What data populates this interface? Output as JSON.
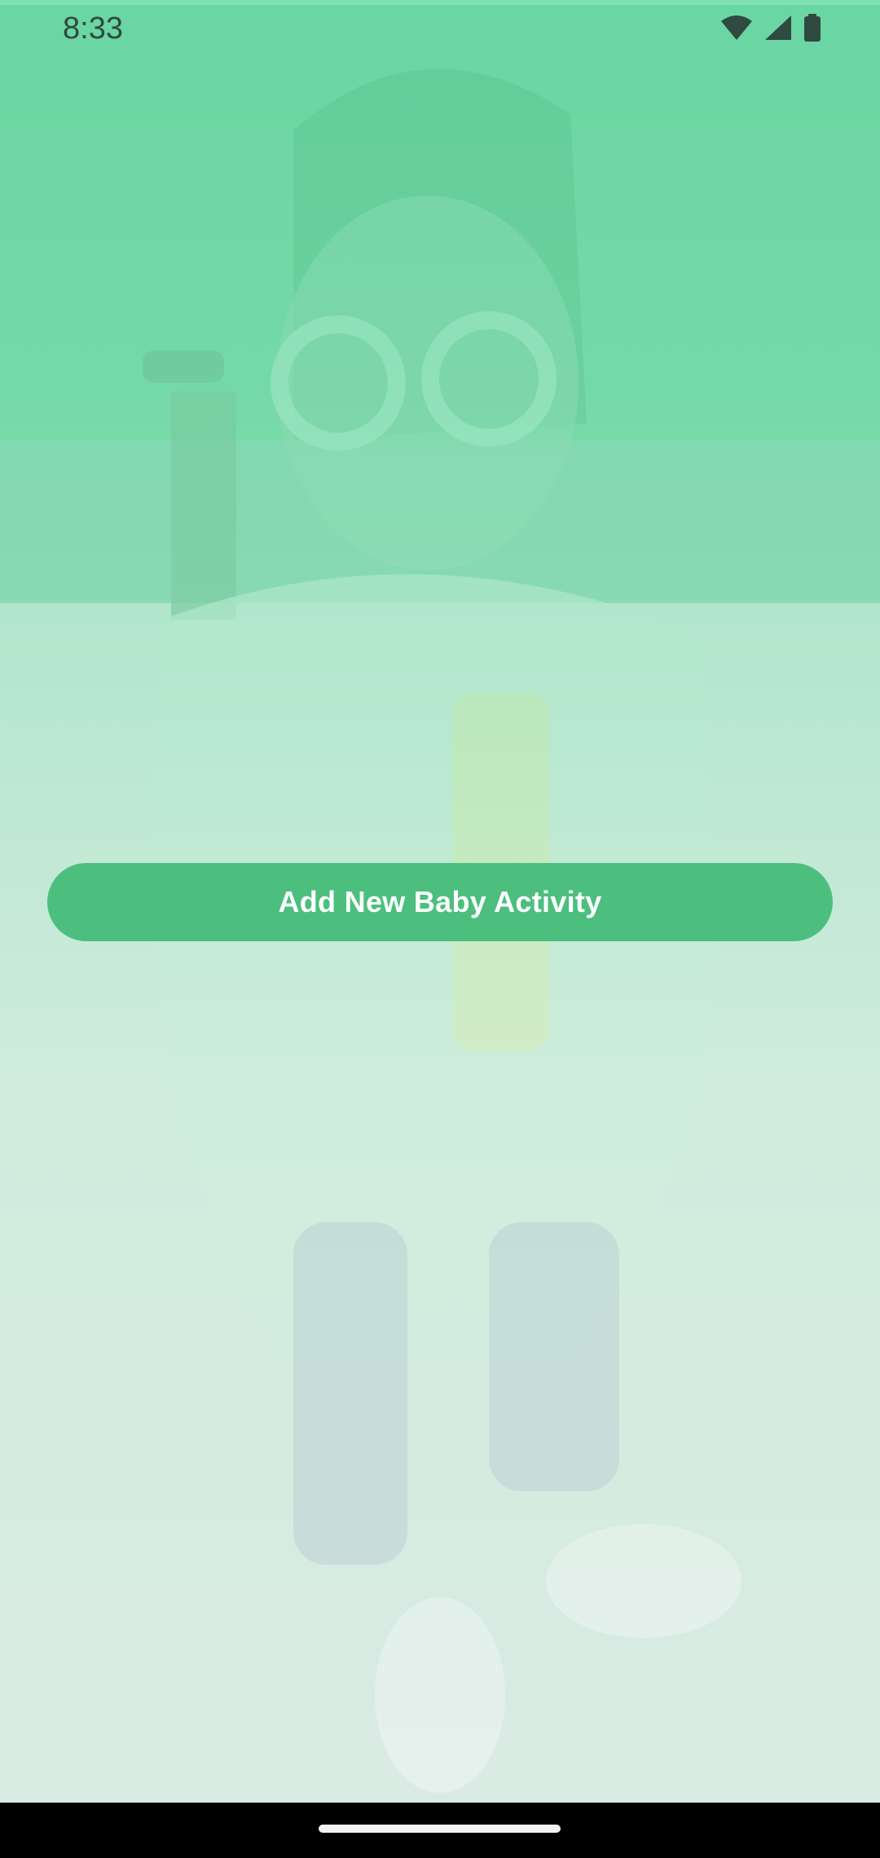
{
  "status_bar": {
    "time": "8:33",
    "icons": [
      "wifi-icon",
      "cellular-signal-icon",
      "battery-icon"
    ]
  },
  "background": {
    "type": "photo",
    "subject": "toddler photo with green gradient overlay"
  },
  "main": {
    "primary_button_label": "Add New Baby Activity"
  },
  "colors": {
    "accent": "#4cbf7f",
    "overlay_top": "#5ed39c",
    "nav_bar": "#000000"
  }
}
